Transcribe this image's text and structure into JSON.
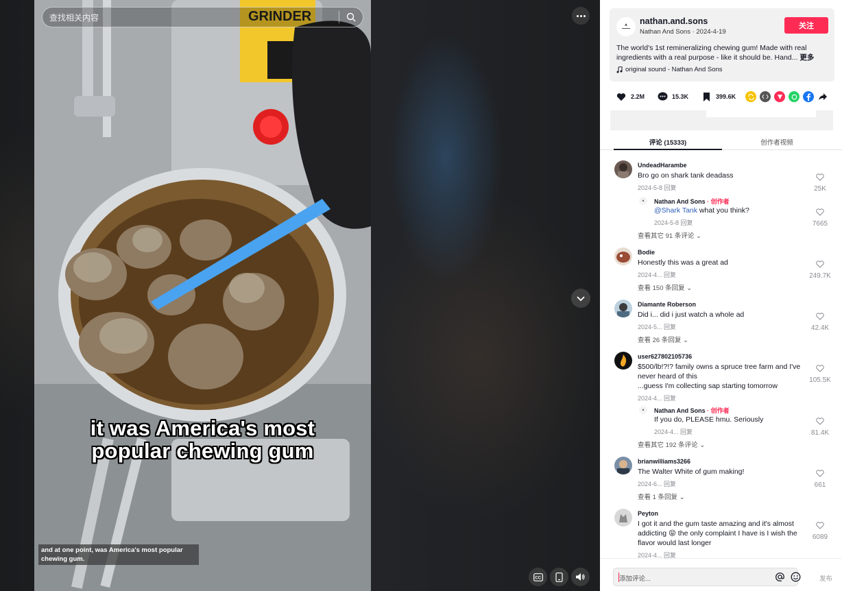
{
  "search": {
    "placeholder": "查找相关内容"
  },
  "video": {
    "caption_line1": "it was America's most",
    "caption_line2": "popular chewing gum",
    "subtitle": "and at one point, was America's most popular chewing gum.",
    "device_label": "GRINDER",
    "controls": [
      "cc-icon",
      "phone-icon",
      "volume-icon"
    ]
  },
  "post": {
    "author": "nathan.and.sons",
    "author_sub": "Nathan And Sons · 2024-4-19",
    "follow_label": "关注",
    "description": "The world's 1st remineralizing chewing gum! Made with real ingredients with a real purpose - like it should be. Hand...",
    "more_label": "更多",
    "music": "original sound - Nathan And Sons"
  },
  "stats": {
    "likes": "2.2M",
    "comments": "15.3K",
    "saves": "399.6K"
  },
  "share_colors": [
    "#f7c300",
    "#555555",
    "#fe2c55",
    "#25d366",
    "#1877f2"
  ],
  "tabs": {
    "comments": "评论 (15333)",
    "creator_videos": "创作者视频"
  },
  "comments": [
    {
      "user": "UndeadHarambe",
      "text": "Bro go on shark tank deadass",
      "meta": "2024-5-8  回复",
      "likes": "25K",
      "reply": {
        "user": "Nathan And Sons",
        "creator": " · 创作者",
        "mention": "@Shark Tank",
        "text": " what you think?",
        "meta": "2024-5-8  回复",
        "likes": "7665"
      },
      "view_more": "查看其它 91 条评论"
    },
    {
      "user": "Bodie",
      "text": "Honestly this was a great ad",
      "meta": "2024-4...  回复",
      "likes": "249.7K",
      "view_more": "查看 150 条回复"
    },
    {
      "user": "Diamante Roberson",
      "text": "Did i... did i just watch a whole ad",
      "meta": "2024-5...  回复",
      "likes": "42.4K",
      "view_more": "查看 26 条回复"
    },
    {
      "user": "user627802105736",
      "text_lines": [
        "$500/lb!?!? family owns a spruce tree farm and I've",
        "never heard of this",
        "...guess I'm collecting sap starting tomorrow"
      ],
      "meta": "2024-4...  回复",
      "likes": "105.5K",
      "reply": {
        "user": "Nathan And Sons",
        "creator": " · 创作者",
        "text": "If you do, PLEASE hmu. Seriously",
        "meta": "2024-4...  回复",
        "likes": "81.4K"
      },
      "view_more": "查看其它 192 条评论"
    },
    {
      "user": "brianwilliams3266",
      "text": "The Walter White of gum making!",
      "meta": "2024-6...  回复",
      "likes": "661",
      "view_more": "查看 1 条回复"
    },
    {
      "user": "Peyton",
      "text_lines": [
        "I got it and the gum taste amazing and it's almost",
        "addicting 😝 the only complaint I have is I wish the",
        "flavor would last longer"
      ],
      "meta": "2024-4...  回复",
      "likes": "6089"
    }
  ],
  "comment_input": {
    "placeholder": "添加评论...",
    "post_label": "发布"
  }
}
